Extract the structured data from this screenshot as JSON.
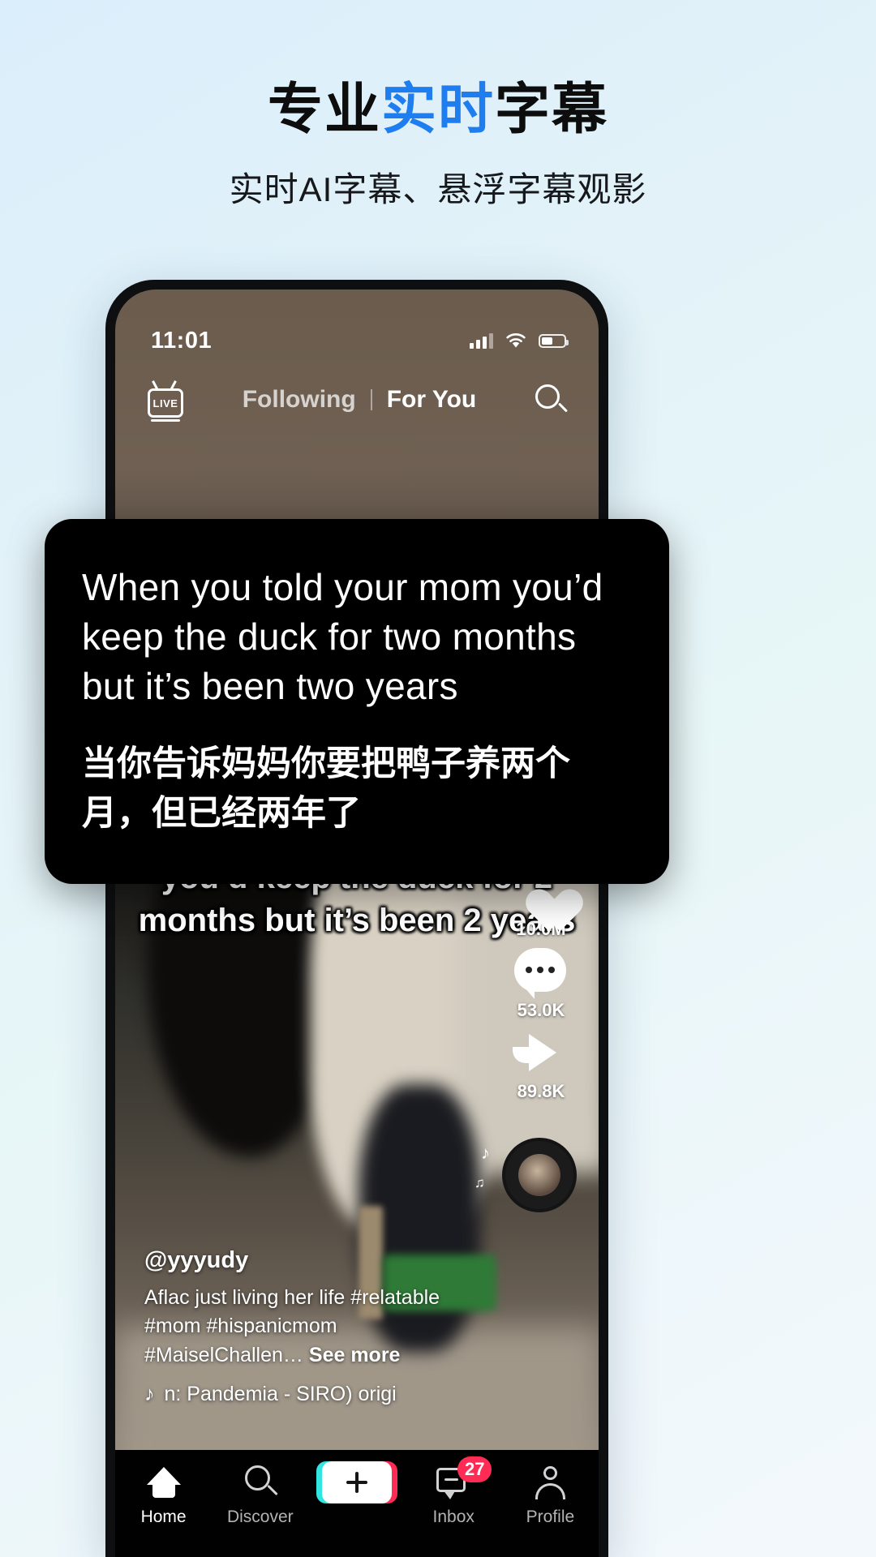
{
  "promo": {
    "title_part1": "专业",
    "title_highlight": "实时",
    "title_part2": "字幕",
    "subtitle": "实时AI字幕、悬浮字幕观影",
    "highlight_color": "#1f7eef"
  },
  "status_bar": {
    "time": "11:01",
    "signal_icon": "cellular-signal-icon",
    "wifi_icon": "wifi-icon",
    "battery_icon": "battery-icon"
  },
  "top_nav": {
    "live_label": "LIVE",
    "tabs": [
      {
        "label": "Following",
        "active": false
      },
      {
        "label": "For You",
        "active": true
      }
    ],
    "search_icon": "search-icon"
  },
  "video": {
    "burned_caption": "When you told your mom you’d keep the duck for 2 months but it’s been 2 years",
    "username": "@yyyudy",
    "description": "Aflac just living her life #relatable #mom #hispanicmom #MaiselChallen…",
    "see_more": "See more",
    "music": "n: Pandemia - SIRO)   origi",
    "music_icon": "music-note-icon"
  },
  "actions": {
    "avatar": "creator-avatar",
    "follow_badge": "+",
    "like": {
      "icon": "heart-icon",
      "count": "10.0M"
    },
    "comment": {
      "icon": "comment-icon",
      "count": "53.0K"
    },
    "share": {
      "icon": "share-arrow-icon",
      "count": "89.8K"
    },
    "disc": "spinning-music-disc"
  },
  "subtitle_card": {
    "english": "When you told your mom you’d keep the duck for two months but it’s been two years",
    "chinese": "当你告诉妈妈你要把鸭子养两个月，但已经两年了"
  },
  "tabbar": {
    "items": [
      {
        "label": "Home",
        "icon": "home-icon",
        "active": true
      },
      {
        "label": "Discover",
        "icon": "search-icon",
        "active": false
      },
      {
        "label": "",
        "icon": "create-plus-icon",
        "active": false
      },
      {
        "label": "Inbox",
        "icon": "inbox-icon",
        "active": false,
        "badge": "27"
      },
      {
        "label": "Profile",
        "icon": "person-icon",
        "active": false
      }
    ]
  }
}
